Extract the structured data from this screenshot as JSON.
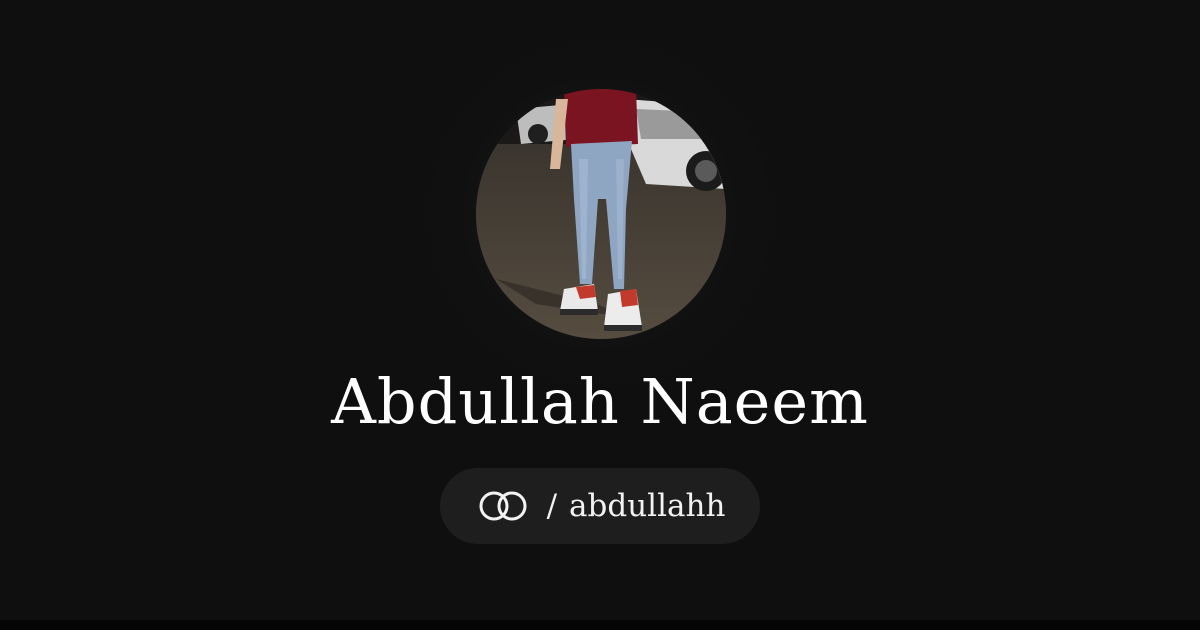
{
  "profile": {
    "name": "Abdullah Naeem",
    "handle_separator": "/",
    "handle": "abdullahh",
    "logo_icon": "linked-rings-icon",
    "avatar_icon": "profile-photo"
  },
  "colors": {
    "background": "#0f0f0f",
    "pill_background": "#1e1e1e",
    "text": "#ffffff"
  }
}
